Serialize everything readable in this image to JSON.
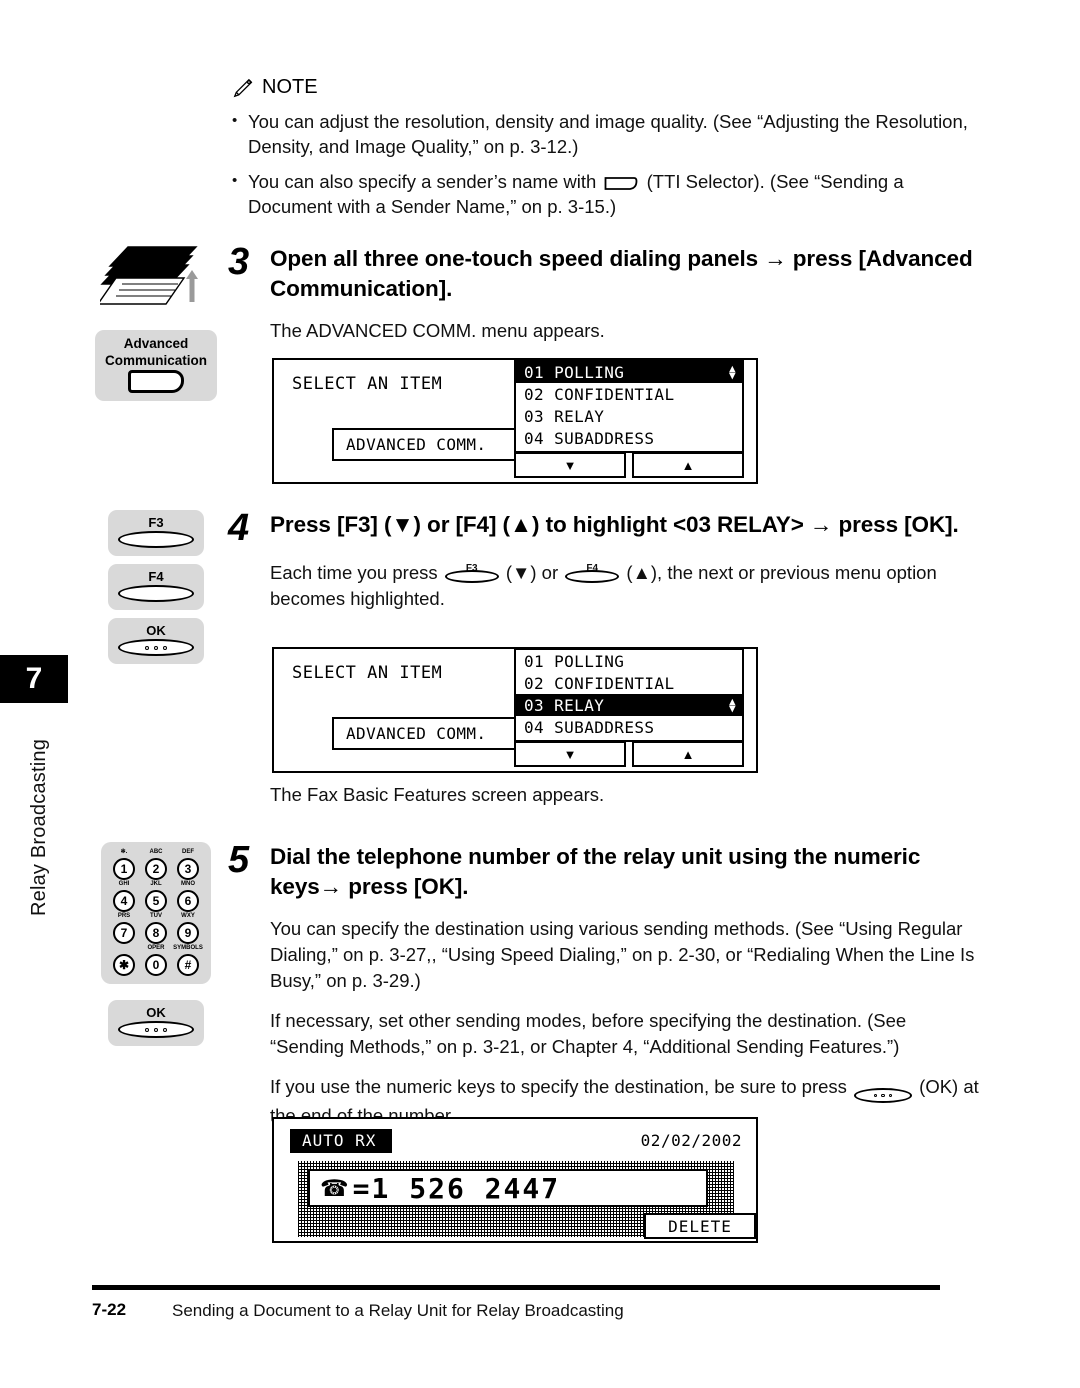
{
  "chapter": {
    "number": "7",
    "label": "Relay Broadcasting"
  },
  "note": {
    "heading": "NOTE",
    "icon": "pencil-icon",
    "items": [
      "You can adjust the resolution, density and image quality. (See “Adjusting the Resolution, Density, and Image Quality,” on p. 3-12.)",
      "You can also specify a sender’s name with ",
      " (TTI Selector). (See “Sending a Document with a Sender Name,” on p. 3-15.)"
    ]
  },
  "step3": {
    "number": "3",
    "title": "Open all three one-touch speed dialing panels → press [Advanced Communication].",
    "para": "The ADVANCED COMM. menu appears.",
    "key": {
      "line1": "Advanced",
      "line2": "Communication"
    },
    "lcd": {
      "title": "SELECT AN ITEM",
      "advanced_box": "ADVANCED COMM.",
      "items": [
        "01 POLLING",
        "02 CONFIDENTIAL",
        "03 RELAY",
        "04 SUBADDRESS"
      ],
      "selected_index": 0,
      "down_button": "▼",
      "up_button": "▲"
    }
  },
  "step4": {
    "number": "4",
    "title_part1": "Press [F3] (▼) or [F4] (▲) to highlight <03 RELAY> → press [OK].",
    "para_a": "Each time you press ",
    "para_b": " (▼) or ",
    "para_c": " (▲), the next or previous menu option becomes highlighted.",
    "para_after": "The Fax Basic Features screen appears.",
    "keys": [
      {
        "label": "F3",
        "type": "lozenge"
      },
      {
        "label": "F4",
        "type": "lozenge"
      },
      {
        "label": "OK",
        "type": "lozenge-dots"
      }
    ],
    "inline_f3": "F3",
    "inline_f4": "F4",
    "lcd": {
      "title": "SELECT AN ITEM",
      "advanced_box": "ADVANCED COMM.",
      "items": [
        "01 POLLING",
        "02 CONFIDENTIAL",
        "03 RELAY",
        "04 SUBADDRESS"
      ],
      "selected_index": 2,
      "down_button": "▼",
      "up_button": "▲"
    }
  },
  "step5": {
    "number": "5",
    "title": "Dial the telephone number of the relay unit using the numeric keys→ press [OK].",
    "para1": "You can specify the destination using various sending methods. (See “Using Regular Dialing,” on p. 3-27,, “Using Speed Dialing,” on p. 2-30, or “Redialing When the Line Is Busy,” on p. 3-29.)",
    "para2": "If necessary, set other sending modes, before specifying the destination. (See “Sending Methods,” on p. 3-21, or Chapter 4, “Additional Sending Features.”)",
    "para3_a": "If you use the numeric keys to specify the destination, be sure to press ",
    "para3_b": " (OK) at the end of the number.",
    "ok_key_label": "OK",
    "keypad": [
      {
        "letters": "✻.",
        "digit": "1"
      },
      {
        "letters": "ABC",
        "digit": "2"
      },
      {
        "letters": "DEF",
        "digit": "3"
      },
      {
        "letters": "GHI",
        "digit": "4"
      },
      {
        "letters": "JKL",
        "digit": "5"
      },
      {
        "letters": "MNO",
        "digit": "6"
      },
      {
        "letters": "PRS",
        "digit": "7"
      },
      {
        "letters": "TUV",
        "digit": "8"
      },
      {
        "letters": "WXY",
        "digit": "9"
      },
      {
        "letters": "",
        "digit": "✱"
      },
      {
        "letters": "OPER",
        "digit": "0"
      },
      {
        "letters": "SYMBOLS",
        "digit": "#"
      }
    ],
    "fax_lcd": {
      "status": "AUTO RX",
      "date": "02/02/2002",
      "tel_icon": "☎",
      "number": "=1  526  2447",
      "delete_button": "DELETE"
    }
  },
  "footer": {
    "page": "7-22",
    "title": "Sending a Document to a Relay Unit for Relay Broadcasting"
  }
}
